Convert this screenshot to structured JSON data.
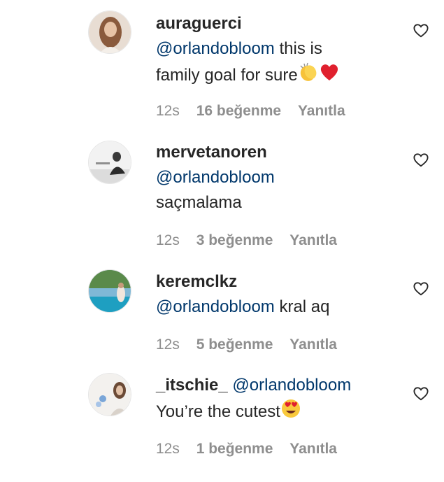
{
  "comments": [
    {
      "username": "auraguerci",
      "mention": "@orlandobloom",
      "text_line1": " this is",
      "text_line2": "family goal for sure",
      "emojis": [
        "clapping-hands",
        "red-heart"
      ],
      "time": "12s",
      "likes": "16 beğenme",
      "reply": "Yanıtla"
    },
    {
      "username": "mervetanoren",
      "mention": "@orlandobloom",
      "text": "saçmalama",
      "time": "12s",
      "likes": "3 beğenme",
      "reply": "Yanıtla"
    },
    {
      "username": "keremclkz",
      "mention": "@orlandobloom",
      "text": " kral aq",
      "time": "12s",
      "likes": "5 beğenme",
      "reply": "Yanıtla"
    },
    {
      "username": "_itschie_",
      "mention": "@orlandobloom",
      "text": "You’re the cutest",
      "emojis": [
        "heart-eyes-face"
      ],
      "time": "12s",
      "likes": "1 beğenme",
      "reply": "Yanıtla"
    }
  ],
  "colors": {
    "text": "#262626",
    "mention": "#00376b",
    "meta": "#8e8e8e"
  },
  "icons": {
    "like": "heart-outline-icon"
  }
}
